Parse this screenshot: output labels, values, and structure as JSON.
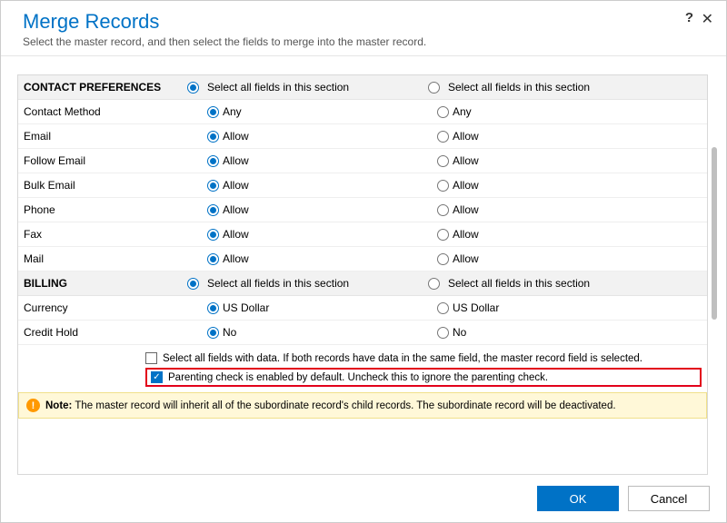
{
  "header": {
    "title": "Merge Records",
    "subtitle": "Select the master record, and then select the fields to merge into the master record.",
    "help_tooltip": "?",
    "close_tooltip": "✕"
  },
  "section_select_label": "Select all fields in this section",
  "sections": [
    {
      "name": "CONTACT PREFERENCES",
      "header_sel": "a",
      "rows": [
        {
          "label": "Contact Method",
          "a": "Any",
          "b": "Any",
          "sel": "a"
        },
        {
          "label": "Email",
          "a": "Allow",
          "b": "Allow",
          "sel": "a"
        },
        {
          "label": "Follow Email",
          "a": "Allow",
          "b": "Allow",
          "sel": "a"
        },
        {
          "label": "Bulk Email",
          "a": "Allow",
          "b": "Allow",
          "sel": "a"
        },
        {
          "label": "Phone",
          "a": "Allow",
          "b": "Allow",
          "sel": "a"
        },
        {
          "label": "Fax",
          "a": "Allow",
          "b": "Allow",
          "sel": "a"
        },
        {
          "label": "Mail",
          "a": "Allow",
          "b": "Allow",
          "sel": "a"
        }
      ]
    },
    {
      "name": "BILLING",
      "header_sel": "a",
      "rows": [
        {
          "label": "Currency",
          "a": "US Dollar",
          "b": "US Dollar",
          "sel": "a"
        },
        {
          "label": "Credit Hold",
          "a": "No",
          "b": "No",
          "sel": "a"
        }
      ]
    }
  ],
  "footer_checks": {
    "select_all_data_label": "Select all fields with data. If both records have data in the same field, the master record field is selected.",
    "select_all_data_checked": false,
    "parenting_label": "Parenting check is enabled by default. Uncheck this to ignore the parenting check.",
    "parenting_checked": true
  },
  "note": {
    "prefix": "Note:",
    "text": "The master record will inherit all of the subordinate record's child records. The subordinate record will be deactivated."
  },
  "buttons": {
    "ok": "OK",
    "cancel": "Cancel"
  }
}
